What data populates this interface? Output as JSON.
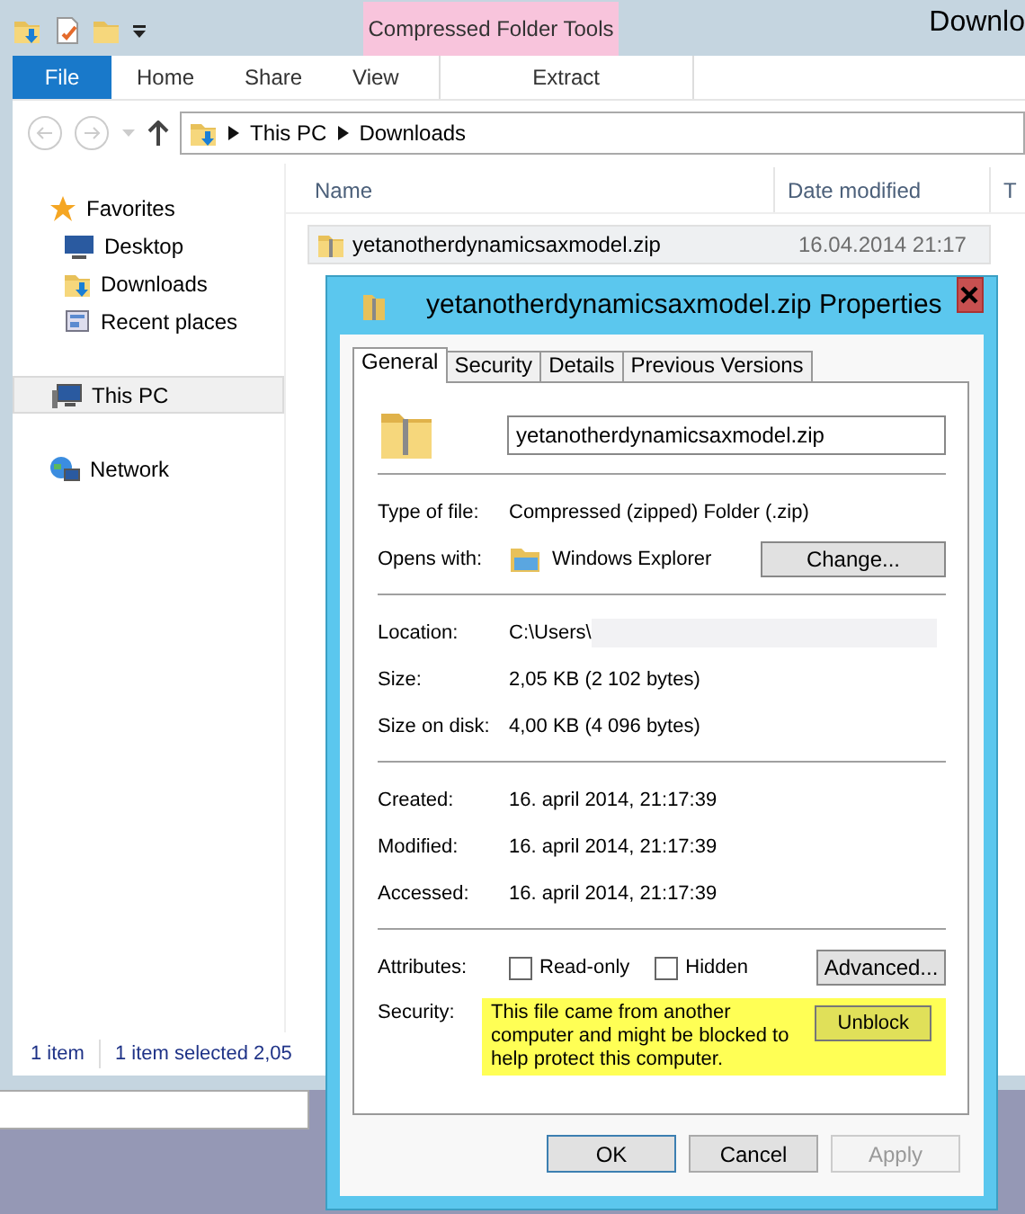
{
  "explorer": {
    "title": "Downlo",
    "contextual_tab": "Compressed Folder Tools",
    "ribbon_tabs": [
      {
        "label": "File",
        "kind": "file"
      },
      {
        "label": "Home",
        "kind": "normal"
      },
      {
        "label": "Share",
        "kind": "normal"
      },
      {
        "label": "View",
        "kind": "normal"
      },
      {
        "label": "Extract",
        "kind": "contextual"
      }
    ],
    "address": [
      "This PC",
      "Downloads"
    ],
    "nav": [
      {
        "label": "Favorites",
        "kind": "star",
        "selected": false,
        "children": [
          {
            "label": "Desktop",
            "kind": "desktop",
            "selected": false
          },
          {
            "label": "Downloads",
            "kind": "downloads",
            "selected": false
          },
          {
            "label": "Recent places",
            "kind": "recent",
            "selected": false
          }
        ]
      },
      {
        "label": "This PC",
        "kind": "pc",
        "selected": true
      },
      {
        "label": "Network",
        "kind": "network",
        "selected": false
      }
    ],
    "columns": [
      "Name",
      "Date modified",
      "T"
    ],
    "files": [
      {
        "name": "yetanotherdynamicsaxmodel.zip",
        "date": "16.04.2014 21:17",
        "selected": true
      }
    ],
    "status": [
      "1 item",
      "1 item selected 2,05"
    ]
  },
  "dialog": {
    "title": "yetanotherdynamicsaxmodel.zip Properties",
    "tabs": [
      {
        "label": "General",
        "selected": true
      },
      {
        "label": "Security",
        "selected": false
      },
      {
        "label": "Details",
        "selected": false
      },
      {
        "label": "Previous Versions",
        "selected": false
      }
    ],
    "filename": "yetanotherdynamicsaxmodel.zip",
    "sections": [
      [
        {
          "label": "Type of file:",
          "value": "Compressed (zipped) Folder (.zip)",
          "kind": "text"
        },
        {
          "label": "Opens with:",
          "value": "Windows Explorer",
          "kind": "app",
          "button": "Change..."
        }
      ],
      [
        {
          "label": "Location:",
          "value": "C:\\Users\\",
          "kind": "redacted"
        },
        {
          "label": "Size:",
          "value": "2,05 KB (2 102 bytes)",
          "kind": "text"
        },
        {
          "label": "Size on disk:",
          "value": "4,00 KB (4 096 bytes)",
          "kind": "text"
        }
      ],
      [
        {
          "label": "Created:",
          "value": "16. april 2014, 21:17:39",
          "kind": "text"
        },
        {
          "label": "Modified:",
          "value": "16. april 2014, 21:17:39",
          "kind": "text"
        },
        {
          "label": "Accessed:",
          "value": "16. april 2014, 21:17:39",
          "kind": "text"
        }
      ]
    ],
    "attributes": {
      "label": "Attributes:",
      "options": [
        {
          "label": "Read-only",
          "checked": false
        },
        {
          "label": "Hidden",
          "checked": false
        }
      ],
      "button": "Advanced..."
    },
    "security": {
      "label": "Security:",
      "message": "This file came from another computer and might be blocked to help protect this computer.",
      "button": "Unblock"
    },
    "buttons": [
      {
        "label": "OK",
        "default": true,
        "disabled": false
      },
      {
        "label": "Cancel",
        "default": false,
        "disabled": false
      },
      {
        "label": "Apply",
        "default": false,
        "disabled": true
      }
    ]
  }
}
